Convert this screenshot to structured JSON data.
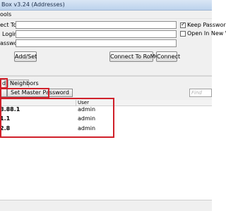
{
  "window": {
    "title": "Box v3.24 (Addresses)"
  },
  "menu": {
    "label": "ools"
  },
  "form": {
    "connect_to": {
      "label": "ect To:",
      "value": ""
    },
    "login": {
      "label": "Login:",
      "value": ""
    },
    "password": {
      "label": "assword:",
      "value": ""
    },
    "keep_password": {
      "label": "Keep Password",
      "checked": true
    },
    "open_new_window": {
      "label": "Open In New W",
      "checked": false
    },
    "buttons": {
      "add_set": "Add/Set",
      "connect_romon": "Connect To RoMON",
      "connect": "Connect"
    }
  },
  "tabs": [
    {
      "label": "d",
      "active": true
    },
    {
      "label": "Neighbors",
      "active": false
    }
  ],
  "toolbar": {
    "left_button": "",
    "set_master_password": "Set Master Password",
    "find_placeholder": "Find"
  },
  "table": {
    "columns": [
      "",
      "User"
    ],
    "rows": [
      {
        "address": "8.88.1",
        "user": "admin"
      },
      {
        "address": "1.1",
        "user": "admin"
      },
      {
        "address": "2.8",
        "user": "admin"
      }
    ]
  },
  "colors": {
    "highlight": "#d0202a",
    "titlebar": "#c9dbf0"
  }
}
